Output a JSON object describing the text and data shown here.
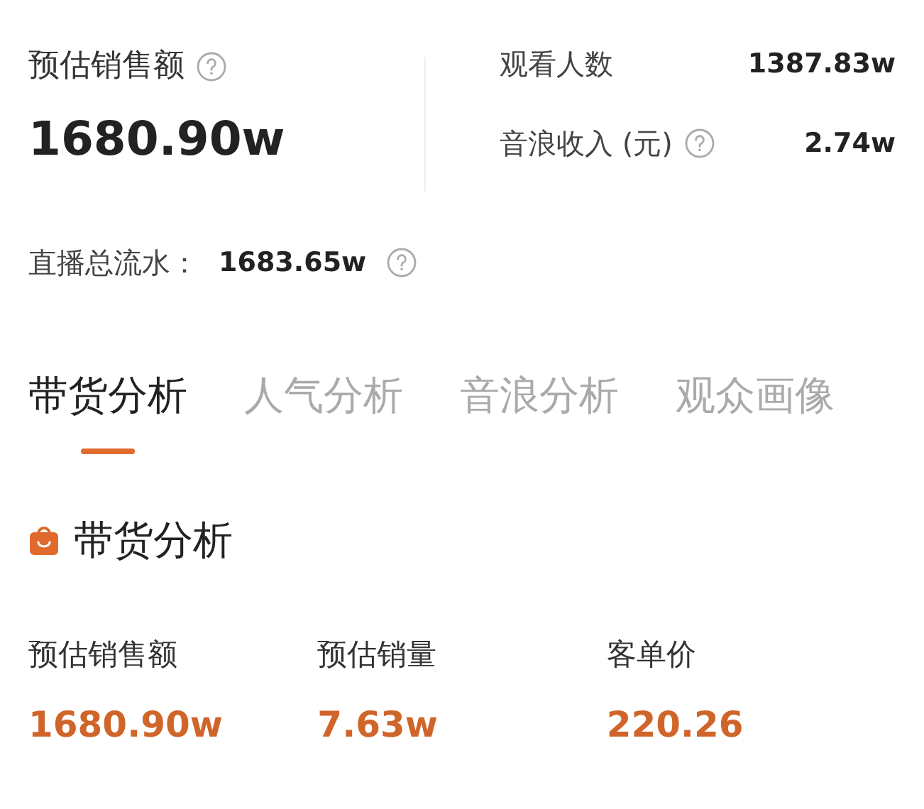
{
  "summary": {
    "main": {
      "label": "预估销售额",
      "value": "1680.90w",
      "help": true
    },
    "stats": [
      {
        "label": "观看人数",
        "value": "1387.83w",
        "help": false
      },
      {
        "label": "音浪收入 (元)",
        "value": "2.74w",
        "help": true
      }
    ],
    "total": {
      "label": "直播总流水：",
      "value": "1683.65w",
      "help": true
    }
  },
  "tabs": [
    {
      "label": "带货分析",
      "selected": true
    },
    {
      "label": "人气分析",
      "selected": false
    },
    {
      "label": "音浪分析",
      "selected": false
    },
    {
      "label": "观众画像",
      "selected": false
    }
  ],
  "section": {
    "title": "带货分析",
    "metrics": [
      {
        "label": "预估销售额",
        "value": "1680.90w"
      },
      {
        "label": "预估销量",
        "value": "7.63w"
      },
      {
        "label": "客单价",
        "value": "220.26"
      }
    ]
  }
}
